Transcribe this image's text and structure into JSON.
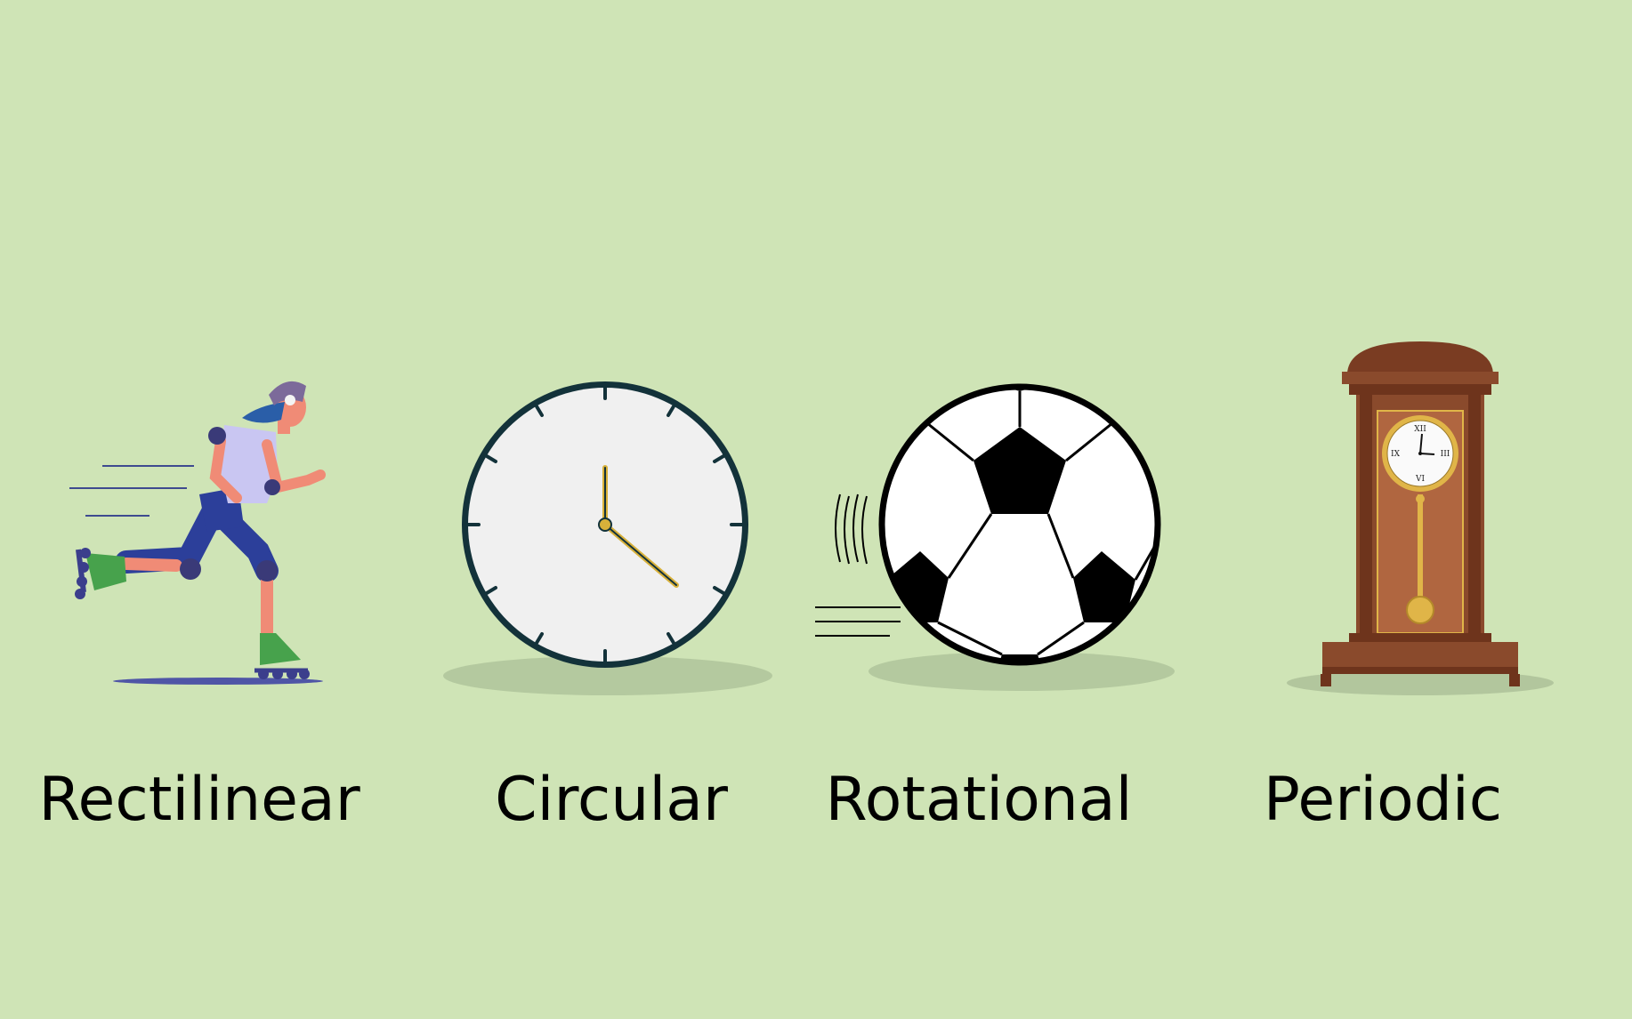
{
  "motions": [
    {
      "label": "Rectilinear",
      "icon": "rollerblader-icon"
    },
    {
      "label": "Circular",
      "icon": "wall-clock-icon"
    },
    {
      "label": "Rotational",
      "icon": "soccer-ball-icon"
    },
    {
      "label": "Periodic",
      "icon": "pendulum-clock-icon"
    }
  ],
  "pendulum_clock": {
    "numerals": [
      "XII",
      "III",
      "VI",
      "IX"
    ]
  },
  "colors": {
    "background": "#cfe4b6",
    "clock_rim": "#13323a",
    "clock_face": "#f0f0f0",
    "wood": "#8a4a2c",
    "brass": "#e0b548"
  }
}
